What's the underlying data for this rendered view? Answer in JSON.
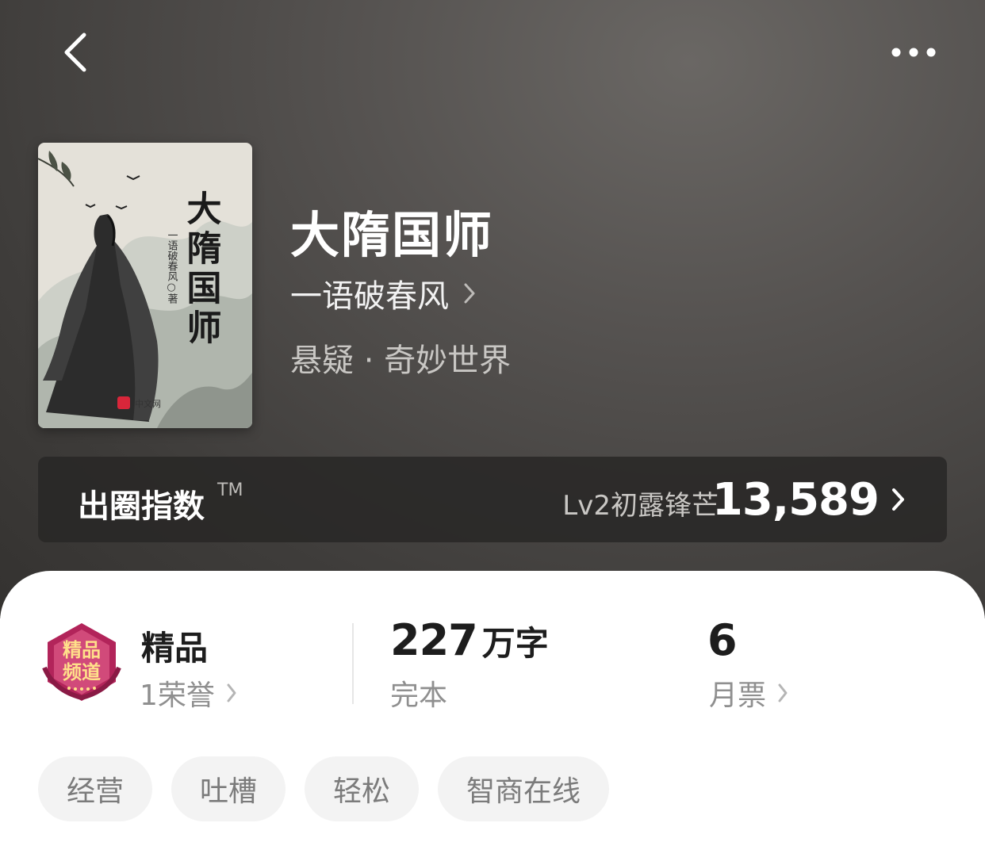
{
  "header": {
    "back_icon": "chevron-left-icon",
    "more_icon": "more-dots-icon"
  },
  "book": {
    "title": "大隋国师",
    "author": "一语破春风",
    "category": "悬疑 · 奇妙世界",
    "cover": {
      "title_vertical": "大隋国师",
      "author_vertical": "一语破春风○著",
      "publisher": "中文网"
    }
  },
  "index_bar": {
    "label": "出圈指数",
    "trademark": "TM",
    "level": "Lv2初露锋芒",
    "value": "13,589"
  },
  "stats": {
    "honor": {
      "badge_text_1": "精品",
      "badge_text_2": "频道",
      "title": "精品",
      "sub": "1荣誉"
    },
    "words": {
      "number": "227",
      "unit": "万字",
      "status": "完本"
    },
    "tickets": {
      "number": "6",
      "label": "月票"
    }
  },
  "tags": [
    "经营",
    "吐槽",
    "轻松",
    "智商在线"
  ],
  "colors": {
    "hero_bg": "#4a4846",
    "index_bar_bg": "#2b2a29",
    "tag_bg": "#f3f3f3",
    "badge_primary": "#b2245a"
  }
}
